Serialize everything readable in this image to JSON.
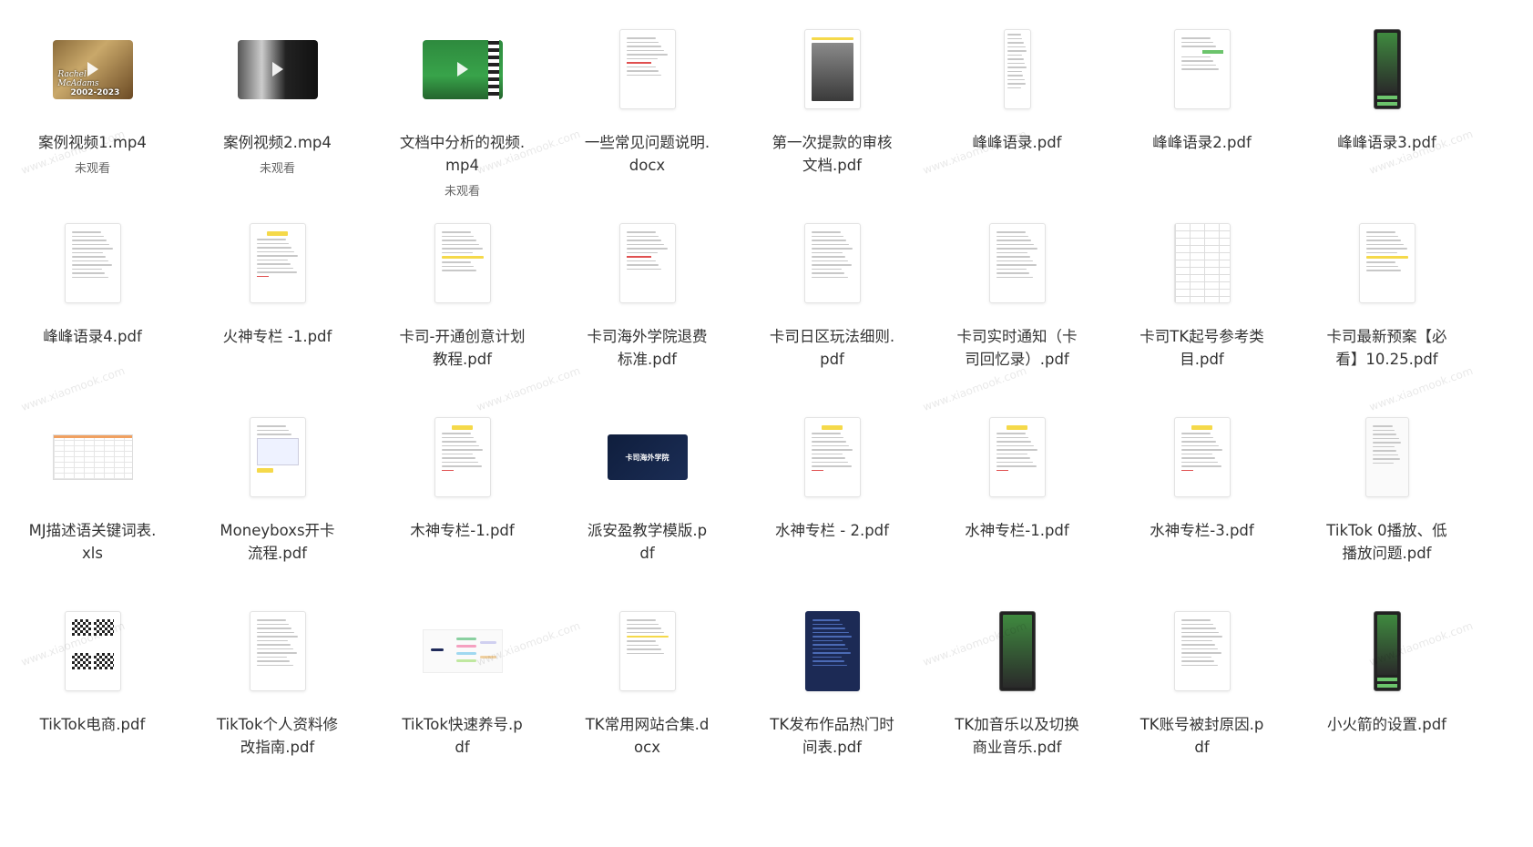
{
  "files": [
    {
      "name": "案例视频1.mp4",
      "status": "未观看",
      "kind": "video",
      "variant": "v1"
    },
    {
      "name": "案例视频2.mp4",
      "status": "未观看",
      "kind": "video",
      "variant": "v2"
    },
    {
      "name": "文档中分析的视频.mp4",
      "status": "未观看",
      "kind": "video",
      "variant": "v3"
    },
    {
      "name": "一些常见问题说明.docx",
      "kind": "doc",
      "variant": "text-red"
    },
    {
      "name": "第一次提款的审核文档.pdf",
      "kind": "doc",
      "variant": "image"
    },
    {
      "name": "峰峰语录.pdf",
      "kind": "doc",
      "variant": "narrow"
    },
    {
      "name": "峰峰语录2.pdf",
      "kind": "doc",
      "variant": "chat"
    },
    {
      "name": "峰峰语录3.pdf",
      "kind": "doc",
      "variant": "phone"
    },
    {
      "name": "峰峰语录4.pdf",
      "kind": "doc",
      "variant": "text"
    },
    {
      "name": "火神专栏 -1.pdf",
      "kind": "doc",
      "variant": "header-yellow"
    },
    {
      "name": "卡司-开通创意计划教程.pdf",
      "kind": "doc",
      "variant": "text-yellow"
    },
    {
      "name": "卡司海外学院退费标准.pdf",
      "kind": "doc",
      "variant": "text-red"
    },
    {
      "name": "卡司日区玩法细则.pdf",
      "kind": "doc",
      "variant": "text"
    },
    {
      "name": "卡司实时通知（卡司回忆录）.pdf",
      "kind": "doc",
      "variant": "text"
    },
    {
      "name": "卡司TK起号参考类目.pdf",
      "kind": "doc",
      "variant": "table"
    },
    {
      "name": "卡司最新预案【必看】10.25.pdf",
      "kind": "doc",
      "variant": "text-yellow"
    },
    {
      "name": "MJ描述语关键词表.xls",
      "kind": "sheet"
    },
    {
      "name": "Moneyboxs开卡流程.pdf",
      "kind": "doc",
      "variant": "screens"
    },
    {
      "name": "木神专栏-1.pdf",
      "kind": "doc",
      "variant": "header-yellow"
    },
    {
      "name": "派安盈教学模版.pdf",
      "kind": "slide",
      "slide_title": "卡司海外学院"
    },
    {
      "name": "水神专栏 - 2.pdf",
      "kind": "doc",
      "variant": "header-yellow"
    },
    {
      "name": "水神专栏-1.pdf",
      "kind": "doc",
      "variant": "header-yellow"
    },
    {
      "name": "水神专栏-3.pdf",
      "kind": "doc",
      "variant": "header-yellow"
    },
    {
      "name": "TikTok 0播放、低播放问题.pdf",
      "kind": "doc",
      "variant": "mindmap-v"
    },
    {
      "name": "TikTok电商.pdf",
      "kind": "doc",
      "variant": "qr"
    },
    {
      "name": "TikTok个人资料修改指南.pdf",
      "kind": "doc",
      "variant": "text"
    },
    {
      "name": "TikTok快速养号.pdf",
      "kind": "mind"
    },
    {
      "name": "TK常用网站合集.docx",
      "kind": "doc",
      "variant": "links"
    },
    {
      "name": "TK发布作品热门时间表.pdf",
      "kind": "doc",
      "variant": "dark"
    },
    {
      "name": "TK加音乐以及切换商业音乐.pdf",
      "kind": "doc",
      "variant": "phone-img"
    },
    {
      "name": "TK账号被封原因.pdf",
      "kind": "doc",
      "variant": "text"
    },
    {
      "name": "小火箭的设置.pdf",
      "kind": "doc",
      "variant": "phone"
    }
  ],
  "watermark_text": "www.xiaomook.com",
  "video_captions": {
    "v1_title": "Rachel McAdams",
    "v1_years": "2002-2023"
  }
}
